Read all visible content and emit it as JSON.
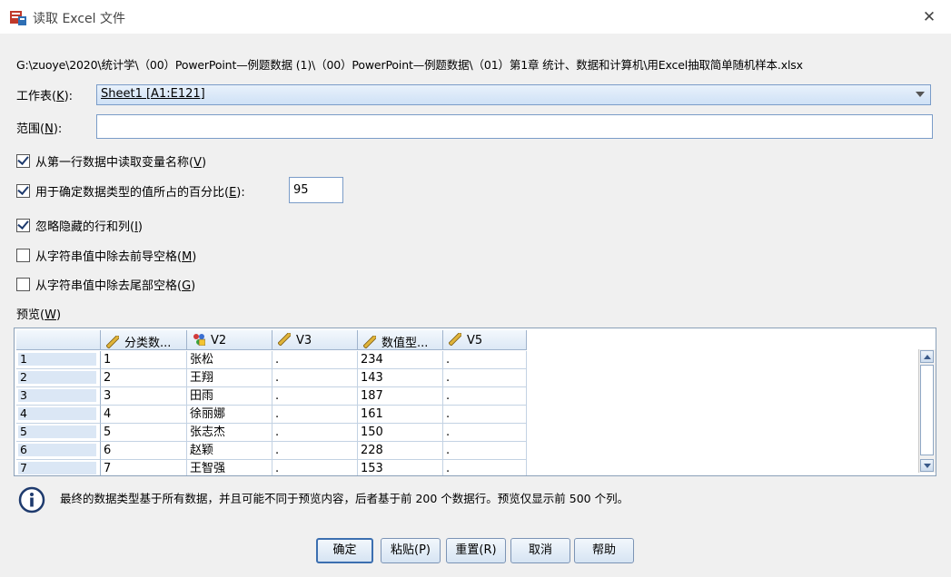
{
  "window": {
    "title": "读取 Excel 文件"
  },
  "file_path": "G:\\zuoye\\2020\\统计学\\（00）PowerPoint—例题数据 (1)\\（00）PowerPoint—例题数据\\（01）第1章  统计、数据和计算机\\用Excel抽取简单随机样本.xlsx",
  "worksheet": {
    "label": "工作表(",
    "key": "K",
    "label_end": "):",
    "value": "Sheet1 [A1:E121]"
  },
  "range": {
    "label": "范围(",
    "key": "N",
    "label_end": "):",
    "value": ""
  },
  "options": [
    {
      "label": "从第一行数据中读取变量名称(",
      "key": "V",
      "end": ")",
      "checked": true
    },
    {
      "label": "用于确定数据类型的值所占的百分比(",
      "key": "E",
      "end": "):",
      "checked": true,
      "value": "95"
    },
    {
      "label": "忽略隐藏的行和列(",
      "key": "I",
      "end": ")",
      "checked": true
    },
    {
      "label": "从字符串值中除去前导空格(",
      "key": "M",
      "end": ")",
      "checked": false
    },
    {
      "label": "从字符串值中除去尾部空格(",
      "key": "G",
      "end": ")",
      "checked": false
    }
  ],
  "preview": {
    "label": "预览(",
    "key": "W",
    "label_end": ")",
    "columns": [
      {
        "name": "分类数...",
        "icon": "scale-ruler-icon"
      },
      {
        "name": "V2",
        "icon": "nominal-string-icon"
      },
      {
        "name": "V3",
        "icon": "scale-ruler-icon"
      },
      {
        "name": "数值型...",
        "icon": "scale-ruler-icon"
      },
      {
        "name": "V5",
        "icon": "scale-ruler-icon"
      }
    ],
    "rows": [
      {
        "num": "1",
        "cells": [
          "1",
          "张松",
          ".",
          "234",
          "."
        ]
      },
      {
        "num": "2",
        "cells": [
          "2",
          "王翔",
          ".",
          "143",
          "."
        ]
      },
      {
        "num": "3",
        "cells": [
          "3",
          "田雨",
          ".",
          "187",
          "."
        ]
      },
      {
        "num": "4",
        "cells": [
          "4",
          "徐丽娜",
          ".",
          "161",
          "."
        ]
      },
      {
        "num": "5",
        "cells": [
          "5",
          "张志杰",
          ".",
          "150",
          "."
        ]
      },
      {
        "num": "6",
        "cells": [
          "6",
          "赵颖",
          ".",
          "228",
          "."
        ]
      },
      {
        "num": "7",
        "cells": [
          "7",
          "王智强",
          ".",
          "153",
          "."
        ]
      }
    ]
  },
  "info_text": "最终的数据类型基于所有数据，并且可能不同于预览内容，后者基于前 200 个数据行。预览仅显示前 500 个列。",
  "buttons": {
    "ok": "确定",
    "paste": "粘贴(P)",
    "reset": "重置(R)",
    "cancel": "取消",
    "help": "帮助"
  }
}
